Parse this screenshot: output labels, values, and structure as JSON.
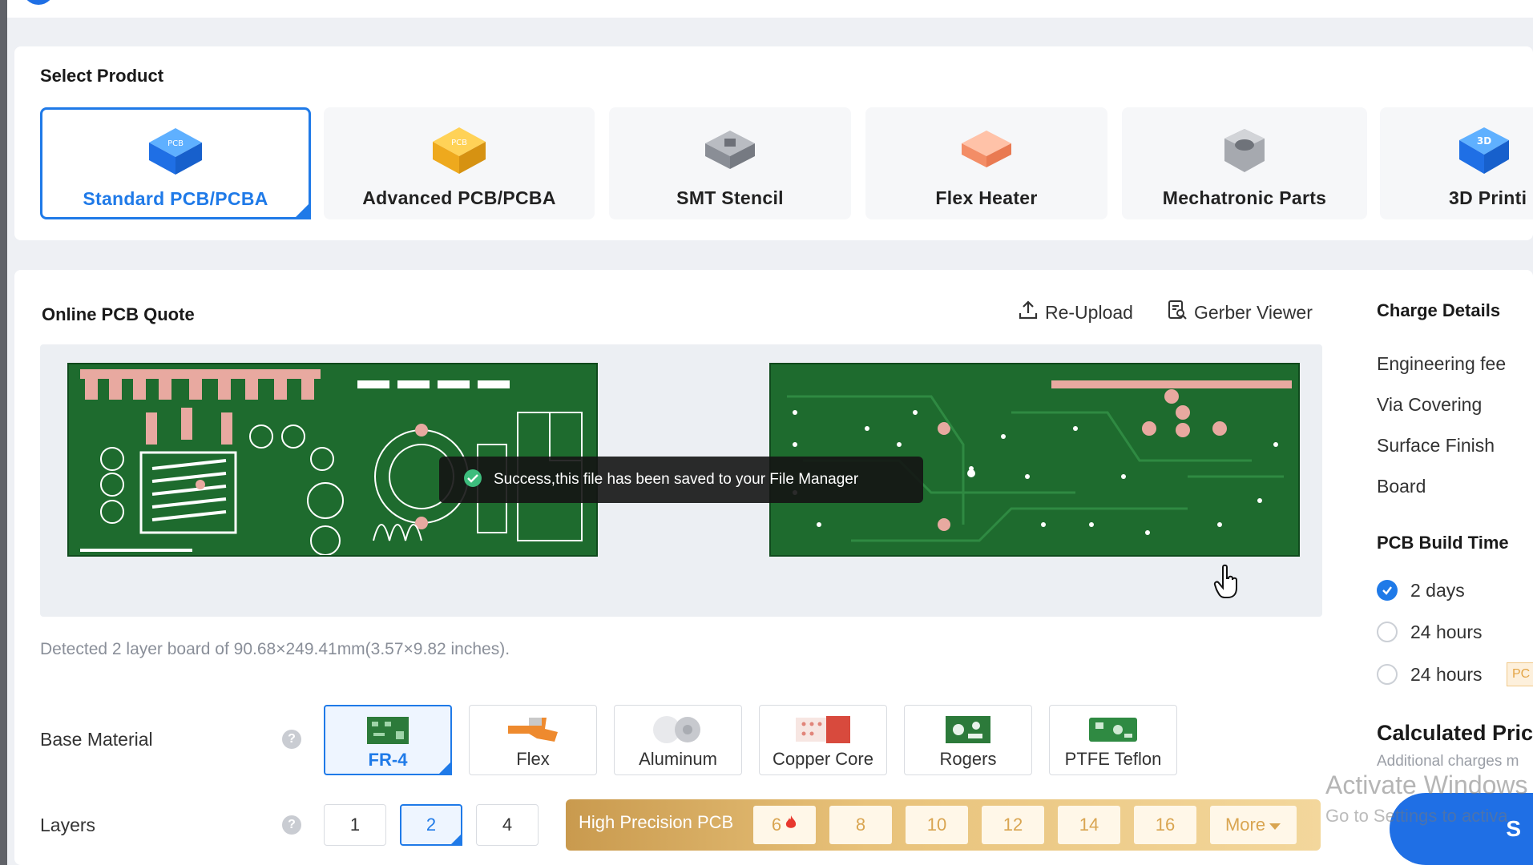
{
  "colors": {
    "accent": "#1f7ae8",
    "pcb_green": "#1e6b2e",
    "gold": "#d9a551"
  },
  "select_product": {
    "title": "Select Product",
    "items": [
      {
        "label": "Standard PCB/PCBA",
        "icon": "pcb-chip-icon",
        "selected": true
      },
      {
        "label": "Advanced PCB/PCBA",
        "icon": "gold-chip-icon"
      },
      {
        "label": "SMT Stencil",
        "icon": "stencil-icon"
      },
      {
        "label": "Flex Heater",
        "icon": "heater-icon"
      },
      {
        "label": "Mechatronic Parts",
        "icon": "nut-icon"
      },
      {
        "label": "3D Printi",
        "icon": "3d-cube-icon"
      }
    ],
    "icon_texts": {
      "pcb": "PCB",
      "three_d": "3D"
    }
  },
  "quote": {
    "title": "Online PCB Quote",
    "reupload_label": "Re-Upload",
    "gerber_viewer_label": "Gerber Viewer",
    "toast": "Success,this file has been saved to your File Manager",
    "detected": "Detected 2 layer board of 90.68×249.41mm(3.57×9.82 inches)."
  },
  "base_material": {
    "label": "Base Material",
    "help": "?",
    "options": [
      {
        "label": "FR-4",
        "selected": true
      },
      {
        "label": "Flex"
      },
      {
        "label": "Aluminum"
      },
      {
        "label": "Copper Core"
      },
      {
        "label": "Rogers"
      },
      {
        "label": "PTFE Teflon"
      }
    ]
  },
  "layers": {
    "label": "Layers",
    "help": "?",
    "options": [
      "1",
      "2",
      "4"
    ],
    "selected": "2",
    "high_precision_label": "High Precision PCB",
    "high_precision_options": [
      "6",
      "8",
      "10",
      "12",
      "14",
      "16"
    ],
    "more_label": "More"
  },
  "charge_details": {
    "title": "Charge Details",
    "items": [
      "Engineering fee",
      "Via Covering",
      "Surface Finish",
      "Board"
    ]
  },
  "build_time": {
    "title": "PCB Build Time",
    "options": [
      {
        "label": "2 days",
        "checked": true
      },
      {
        "label": "24 hours"
      },
      {
        "label": "24 hours"
      }
    ],
    "tag_fragment": "PC"
  },
  "calculated": {
    "title": "Calculated Pric",
    "subtitle": "Additional charges m"
  },
  "watermark": {
    "line1": "Activate Windows",
    "line2": "Go to Settings to activa"
  },
  "submit_label": "S"
}
